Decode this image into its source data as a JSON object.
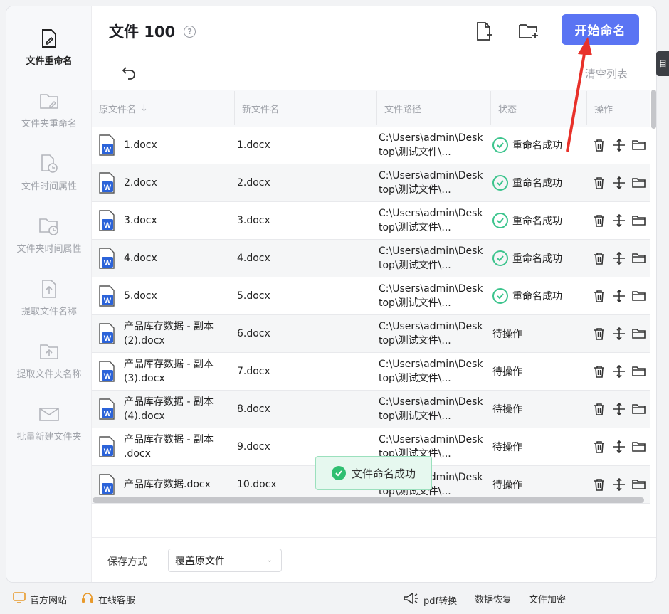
{
  "sidebar": {
    "items": [
      {
        "label": "文件重命名",
        "icon": "file-rename-icon",
        "active": true
      },
      {
        "label": "文件夹重命名",
        "icon": "folder-rename-icon"
      },
      {
        "label": "文件时间属性",
        "icon": "file-time-icon"
      },
      {
        "label": "文件夹时间属性",
        "icon": "folder-time-icon"
      },
      {
        "label": "提取文件名称",
        "icon": "extract-file-name-icon"
      },
      {
        "label": "提取文件夹名称",
        "icon": "extract-folder-name-icon"
      },
      {
        "label": "批量新建文件夹",
        "icon": "batch-new-folder-icon"
      }
    ]
  },
  "header": {
    "title": "文件 100",
    "help": "?",
    "start_button": "开始命名",
    "clear_list": "清空列表"
  },
  "table": {
    "columns": [
      "原文件名",
      "新文件名",
      "文件路径",
      "状态",
      "操作"
    ],
    "rows": [
      {
        "orig": "1.docx",
        "new": "1.docx",
        "path": "C:\\Users\\admin\\Desktop\\测试文件\\...",
        "status": "重命名成功",
        "ok": true
      },
      {
        "orig": "2.docx",
        "new": "2.docx",
        "path": "C:\\Users\\admin\\Desktop\\测试文件\\...",
        "status": "重命名成功",
        "ok": true
      },
      {
        "orig": "3.docx",
        "new": "3.docx",
        "path": "C:\\Users\\admin\\Desktop\\测试文件\\...",
        "status": "重命名成功",
        "ok": true
      },
      {
        "orig": "4.docx",
        "new": "4.docx",
        "path": "C:\\Users\\admin\\Desktop\\测试文件\\...",
        "status": "重命名成功",
        "ok": true
      },
      {
        "orig": "5.docx",
        "new": "5.docx",
        "path": "C:\\Users\\admin\\Desktop\\测试文件\\...",
        "status": "重命名成功",
        "ok": true
      },
      {
        "orig": "产品库存数据 - 副本 (2).docx",
        "new": "6.docx",
        "path": "C:\\Users\\admin\\Desktop\\测试文件\\...",
        "status": "待操作",
        "ok": false
      },
      {
        "orig": "产品库存数据 - 副本 (3).docx",
        "new": "7.docx",
        "path": "C:\\Users\\admin\\Desktop\\测试文件\\...",
        "status": "待操作",
        "ok": false
      },
      {
        "orig": "产品库存数据 - 副本 (4).docx",
        "new": "8.docx",
        "path": "C:\\Users\\admin\\Desktop\\测试文件\\...",
        "status": "待操作",
        "ok": false
      },
      {
        "orig": "产品库存数据 - 副本 .docx",
        "new": "9.docx",
        "path": "C:\\Users\\admin\\Desktop\\测试文件\\...",
        "status": "待操作",
        "ok": false
      },
      {
        "orig": "产品库存数据.docx",
        "new": "10.docx",
        "path": "C:\\Users\\admin\\Desktop\\测试文件\\...",
        "status": "待操作",
        "ok": false
      }
    ]
  },
  "save": {
    "label": "保存方式",
    "value": "覆盖原文件"
  },
  "toast": {
    "text": "文件命名成功"
  },
  "bottom": {
    "official_site": "官方网站",
    "online_service": "在线客服",
    "pdf_convert": "pdf转换",
    "data_recovery": "数据恢复",
    "file_encrypt": "文件加密"
  },
  "colors": {
    "accent": "#5a74f3",
    "success": "#3cc48d",
    "annotation_arrow": "#e8312a"
  }
}
